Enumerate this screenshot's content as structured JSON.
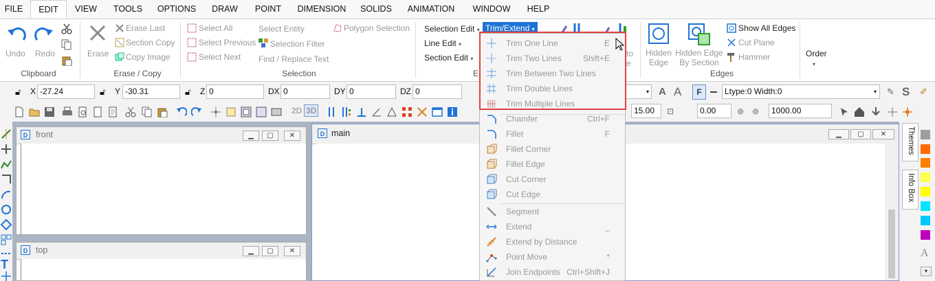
{
  "menu": [
    "FILE",
    "EDIT",
    "VIEW",
    "TOOLS",
    "OPTIONS",
    "DRAW",
    "POINT",
    "DIMENSION",
    "SOLIDS",
    "ANIMATION",
    "WINDOW",
    "HELP"
  ],
  "ribbon": {
    "undo": "Undo",
    "redo": "Redo",
    "clipboard": "Clipboard",
    "erase": "Erase",
    "erase_last": "Erase Last",
    "section_copy": "Section Copy",
    "copy_image": "Copy Image",
    "erase_copy": "Erase / Copy",
    "select_all": "Select All",
    "select_previous": "Select Previous",
    "select_next": "Select Next",
    "select_entity": "Select Entity",
    "selection_filter": "Selection Filter",
    "find_replace": "Find / Replace Text",
    "polygon_selection": "Polygon Selection",
    "selection": "Selection",
    "selection_edit": "Selection Edit",
    "line_edit": "Line Edit",
    "section_edit": "Section Edit",
    "trim_extend": "Trim/Extend",
    "edit_group_partial": "E",
    "to_partial": "to",
    "e_partial": "e",
    "hidden_edge": "Hidden\nEdge",
    "hidden_edge_by_section": "Hidden Edge\nBy Section",
    "show_all_edges": "Show All Edges",
    "cut_plane": "Cut Plane",
    "hammer": "Hammer",
    "edges": "Edges",
    "order": "Order"
  },
  "coords": {
    "x_label": "X",
    "x_value": "-27.24",
    "y_label": "Y",
    "y_value": "-30.31",
    "z_label": "Z",
    "z_value": "0",
    "dx_label": "DX",
    "dx_value": "0",
    "dy_label": "DY",
    "dy_value": "0",
    "dz_label": "DZ",
    "dz_value": "0",
    "ltype": "Ltype:0  Width:0"
  },
  "toolbar2": {
    "mode_2d": "2D",
    "mode_3d": "3D",
    "val1": "15.00",
    "val2": "0.00",
    "val3": "1000.00"
  },
  "windows": {
    "front": "front",
    "main": "main",
    "top": "top"
  },
  "side_tabs": {
    "themes": "Themes",
    "info_box": "Info Box"
  },
  "dropdown": [
    {
      "label": "Trim One Line",
      "shortcut": "E",
      "icon": "trim-one-line-icon"
    },
    {
      "label": "Trim Two Lines",
      "shortcut": "Shift+E",
      "icon": "trim-two-lines-icon"
    },
    {
      "label": "Trim Between Two Lines",
      "shortcut": "",
      "icon": "trim-between-icon"
    },
    {
      "label": "Trim Double Lines",
      "shortcut": "",
      "icon": "trim-double-icon"
    },
    {
      "label": "Trim Multiple Lines",
      "shortcut": "",
      "icon": "trim-multiple-icon"
    },
    {
      "label": "Chamfer",
      "shortcut": "Ctrl+F",
      "icon": "chamfer-icon"
    },
    {
      "label": "Fillet",
      "shortcut": "F",
      "icon": "fillet-icon"
    },
    {
      "label": "Fillet Corner",
      "shortcut": "",
      "icon": "fillet-corner-icon"
    },
    {
      "label": "Fillet Edge",
      "shortcut": "",
      "icon": "fillet-edge-icon"
    },
    {
      "label": "Cut Corner",
      "shortcut": "",
      "icon": "cut-corner-icon"
    },
    {
      "label": "Cut Edge",
      "shortcut": "",
      "icon": "cut-edge-icon"
    },
    {
      "label": "Segment",
      "shortcut": "",
      "icon": "segment-icon"
    },
    {
      "label": "Extend",
      "shortcut": "_",
      "icon": "extend-icon"
    },
    {
      "label": "Extend by Distance",
      "shortcut": "",
      "icon": "extend-distance-icon"
    },
    {
      "label": "Point Move",
      "shortcut": "*",
      "icon": "point-move-icon"
    },
    {
      "label": "Join Endpoints",
      "shortcut": "Ctrl+Shift+J",
      "icon": "join-endpoints-icon"
    }
  ],
  "colors": {
    "accent": "#1f73d6",
    "highlight": "#e0413f",
    "swatches": [
      "#9e9e9e",
      "#ff6a00",
      "#ff7f00",
      "#ffff4d",
      "#ffff00",
      "#00e5ff",
      "#00c8ff",
      "#c000c0"
    ]
  }
}
